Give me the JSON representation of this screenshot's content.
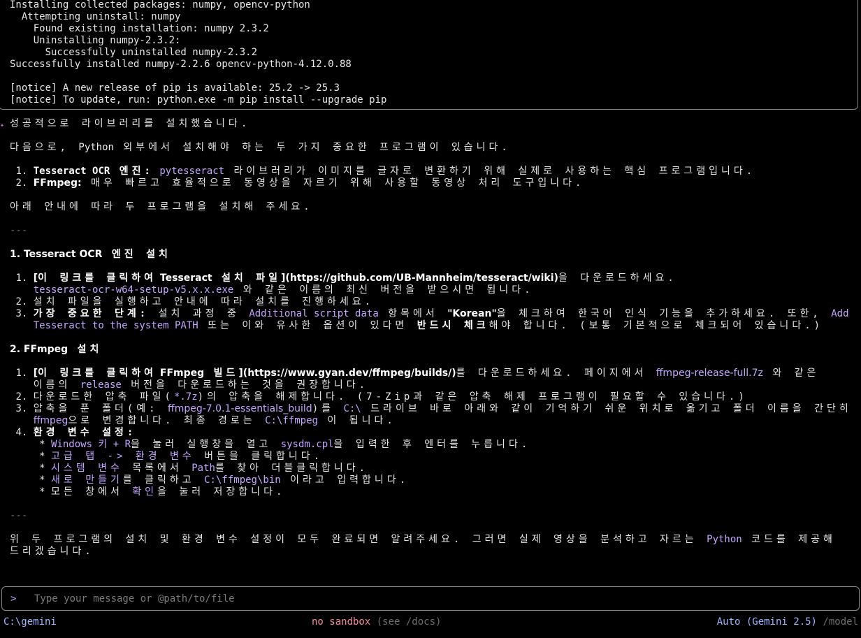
{
  "output": {
    "lines": [
      "Installing collected packages: numpy, opencv-python",
      "  Attempting uninstall: numpy",
      "    Found existing installation: numpy 2.3.2",
      "    Uninstalling numpy-2.3.2:",
      "      Successfully uninstalled numpy-2.3.2",
      "Successfully installed numpy-2.2.6 opencv-python-4.12.0.88",
      "",
      "[notice] A new release of pip is available: 25.2 -> 25.3",
      "[notice] To update, run: python.exe -m pip install --upgrade pip"
    ]
  },
  "response": {
    "marker": "✦",
    "intro": "성공적으로 라이브러리를 설치했습니다.",
    "next_a": "다음으로, ",
    "next_b": "Python",
    "next_c": " 외부에서 설치해야 하는 두 가지 중요한 프로그램이 있습니다.",
    "items": [
      {
        "num": "1.",
        "name": "Tesseract OCR",
        "name_suffix": " 엔진:",
        "lib": " pytesseract",
        "desc": " 라이브러리가 이미지를 글자로 변환하기 위해 실제로 사용하는 핵심 프로그램입니다."
      },
      {
        "num": "2.",
        "name": "FFmpeg:",
        "name_suffix": "",
        "lib": "",
        "desc": " 매우 빠르고 효율적으로 동영상을 자르기 위해 사용할 동영상 처리 도구입니다."
      }
    ],
    "guide": "아래 안내에 따라 두 프로그램을 설치해 주세요.",
    "separator": "---",
    "sec1": {
      "title_a": "1. Tesseract OCR",
      "title_b": " 엔진 설치",
      "s1_num": "1.",
      "s1_link_open": "[",
      "s1_link_kr": "이 링크를 클릭하여",
      "s1_link_en": " Tesseract",
      "s1_link_kr2": " 설치 파일",
      "s1_link_close": "](https://github.com/UB-Mannheim/tesseract/wiki)",
      "s1_after": "을 다운로드하세요.",
      "s1_file": "tesseract-ocr-w64-setup-v5.x.x.exe",
      "s1_file_after": " 와 같은 이름의 최신 버전을 받으시면 됩니다.",
      "s2_num": "2.",
      "s2": "설치 파일을 실행하고 안내에 따라 설치를 진행하세요.",
      "s3_num": "3.",
      "s3_bold": "가장 중요한 단계:",
      "s3_a": " 설치 과정 중 ",
      "s3_purple": "Additional script data",
      "s3_b": " 항목에서 ",
      "s3_korean": "\"Korean\"",
      "s3_c": "을 체크하여 한국어 인식 기능을 추가하세요. 또한, ",
      "s3_add": "Add",
      "s3_add2": "Tesseract to the system PATH",
      "s3_d": " 또는 이와 유사한 옵션이 있다면 ",
      "s3_must": "반드시 체크",
      "s3_e": "해야 합니다. (보통 기본적으로 체크되어 있습니다.)"
    },
    "sec2": {
      "title_a": "2. FFmpeg",
      "title_b": " 설치",
      "s1_num": "1.",
      "s1_link_open": "[",
      "s1_link_kr": "이 링크를 클릭하여",
      "s1_link_en": " FFmpeg",
      "s1_link_kr2": " 빌드",
      "s1_link_close": "](https://www.gyan.dev/ffmpeg/builds/)",
      "s1_after": "를 다운로드하세요. 페이지에서 ",
      "s1_file": "ffmpeg-release-full.7z",
      "s1_after2": " 와 같은",
      "s1_line2_a": "이름의 ",
      "s1_release": "release",
      "s1_line2_b": " 버전을 다운로드하는 것을 권장합니다.",
      "s2_num": "2.",
      "s2_a": "다운로드한 압축 파일(",
      "s2_ext": "*.7z",
      "s2_b": ")의 압축을 해제합니다. (7-Zip과 같은 압축 해제 프로그램이 필요할 수 있습니다.)",
      "s3_num": "3.",
      "s3_a": "압축을 푼 폴더(예: ",
      "s3_folder": "ffmpeg-7.0.1-essentials_build",
      "s3_b": ")를 ",
      "s3_c": "C:\\",
      "s3_d": " 드라이브 바로 아래와 같이 기억하기 쉬운 위치로 옮기고 폴더 이름을 간단히",
      "s3_ff": "ffmpeg",
      "s3_e": "으로 변경합니다. 최종 경로는 ",
      "s3_path": "C:\\ffmpeg",
      "s3_f": " 이 됩니다.",
      "s4_num": "4.",
      "s4_bold": "환경 변수 설정:",
      "b1_a": "Windows 키 + R",
      "b1_b": "을 눌러 실행창을 열고 ",
      "b1_c": "sysdm.cpl",
      "b1_d": "을 입력한 후 엔터를 누릅니다.",
      "b2_a": "고급 탭 -> 환경 변수",
      "b2_b": " 버튼을 클릭합니다.",
      "b3_a": "시스템 변수",
      "b3_b": " 목록에서 ",
      "b3_c": "Path",
      "b3_d": "를 찾아 더블클릭합니다.",
      "b4_a": "새로 만들기",
      "b4_b": "를 클릭하고 ",
      "b4_c": "C:\\ffmpeg\\bin",
      "b4_d": " 이라고 입력합니다.",
      "b5_a": "모든 창에서 ",
      "b5_b": "확인",
      "b5_c": "을 눌러 저장합니다."
    },
    "closing_a": "위 두 프로그램의 설치 및 환경 변수 설정이 모두 완료되면 알려주세요. 그러면 실제 영상을 분석하고 자르는 ",
    "closing_py": "Python",
    "closing_b": " 코드를 제공해",
    "closing_c": "드리겠습니다."
  },
  "input": {
    "prompt": ">",
    "placeholder": "Type your message or @path/to/file"
  },
  "footer": {
    "cwd": "C:\\gemini",
    "sandbox": "no sandbox",
    "sandbox_hint": " (see /docs)",
    "model": "Auto (Gemini 2.5)",
    "model_cmd": " /model"
  },
  "colors": {
    "background": "#000000",
    "accent_purple": "#c3a6ff",
    "accent_blue": "#9bb8ff",
    "accent_pink": "#f28b9a",
    "marker_magenta": "#d36dd1"
  }
}
